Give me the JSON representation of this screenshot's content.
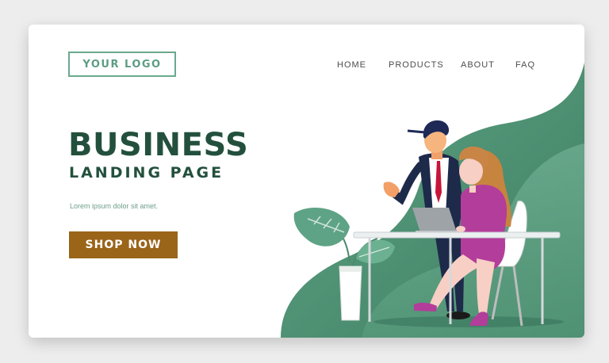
{
  "header": {
    "logo_text": "YOUR LOGO",
    "nav": [
      {
        "label": "HOME"
      },
      {
        "label": "PRODUCTS"
      },
      {
        "label": "ABOUT"
      },
      {
        "label": "FAQ"
      }
    ]
  },
  "hero": {
    "title": "BUSINESS",
    "subtitle": "LANDING PAGE",
    "text": "Lorem ipsum dolor sit amet.",
    "cta_label": "SHOP NOW"
  },
  "colors": {
    "primary_green": "#23503d",
    "accent_green": "#5fa384",
    "button": "#9a6419",
    "tie": "#c8153a",
    "dress": "#b33d9a"
  },
  "illustration": {
    "icons": [
      "background-blob",
      "man-figure",
      "woman-figure",
      "laptop-icon",
      "desk",
      "chair",
      "potted-plant-icon"
    ]
  }
}
